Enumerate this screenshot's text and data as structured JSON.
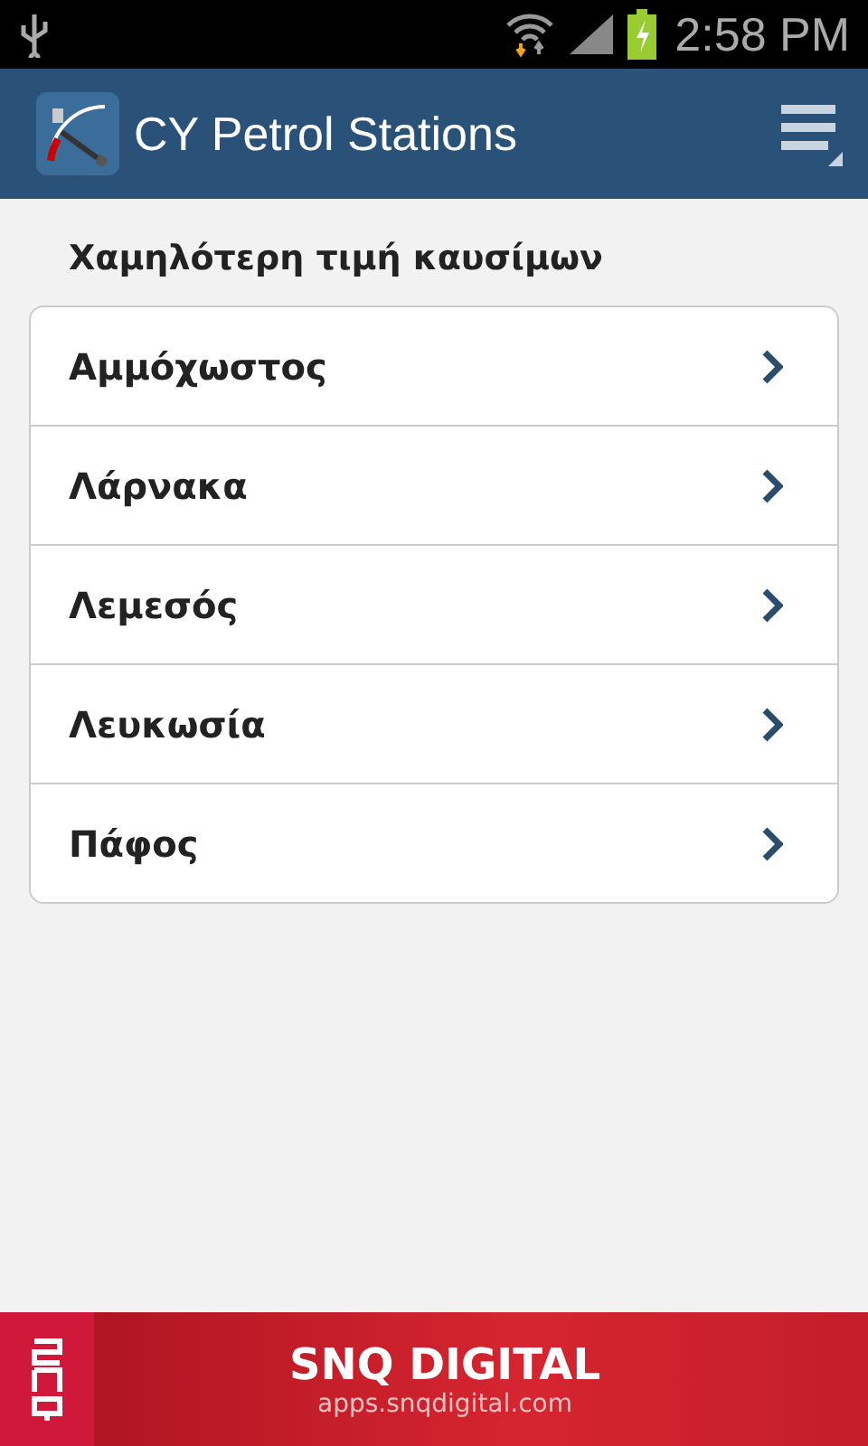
{
  "status_bar": {
    "time": "2:58 PM"
  },
  "action_bar": {
    "title": "CY Petrol Stations"
  },
  "section_title": "Χαμηλότερη τιμή καυσίμων",
  "items": [
    {
      "label": "Αμμόχωστος"
    },
    {
      "label": "Λάρνακα"
    },
    {
      "label": "Λεμεσός"
    },
    {
      "label": "Λευκωσία"
    },
    {
      "label": "Πάφος"
    }
  ],
  "ad_banner": {
    "title": "SNQ DIGITAL",
    "url": "apps.snqdigital.com"
  }
}
